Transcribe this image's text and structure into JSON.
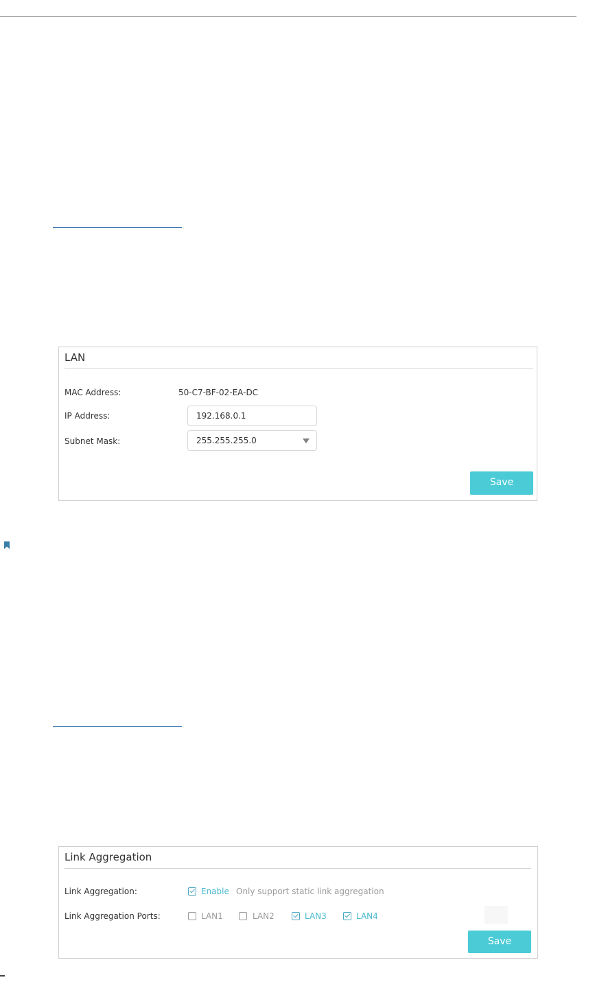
{
  "lan_panel": {
    "title": "LAN",
    "mac_label": "MAC Address:",
    "mac_value": "50-C7-BF-02-EA-DC",
    "ip_label": "IP Address:",
    "ip_value": "192.168.0.1",
    "mask_label": "Subnet Mask:",
    "mask_value": "255.255.255.0",
    "save_label": "Save"
  },
  "link_agg_panel": {
    "title": "Link Aggregation",
    "agg_label": "Link Aggregation:",
    "enable_label": "Enable",
    "enable_checked": true,
    "enable_note": "Only support static link aggregation",
    "ports_label": "Link Aggregation Ports:",
    "ports": [
      {
        "label": "LAN1",
        "checked": false
      },
      {
        "label": "LAN2",
        "checked": false
      },
      {
        "label": "LAN3",
        "checked": true
      },
      {
        "label": "LAN4",
        "checked": true
      }
    ],
    "save_label": "Save"
  },
  "colors": {
    "accent": "#4acbd6",
    "checked_text": "#4ab8d0",
    "link_rule": "#3c78b4"
  },
  "icons": {
    "bookmark": "bookmark-icon",
    "dropdown": "caret-down-icon",
    "checkbox": "checkbox-icon"
  }
}
